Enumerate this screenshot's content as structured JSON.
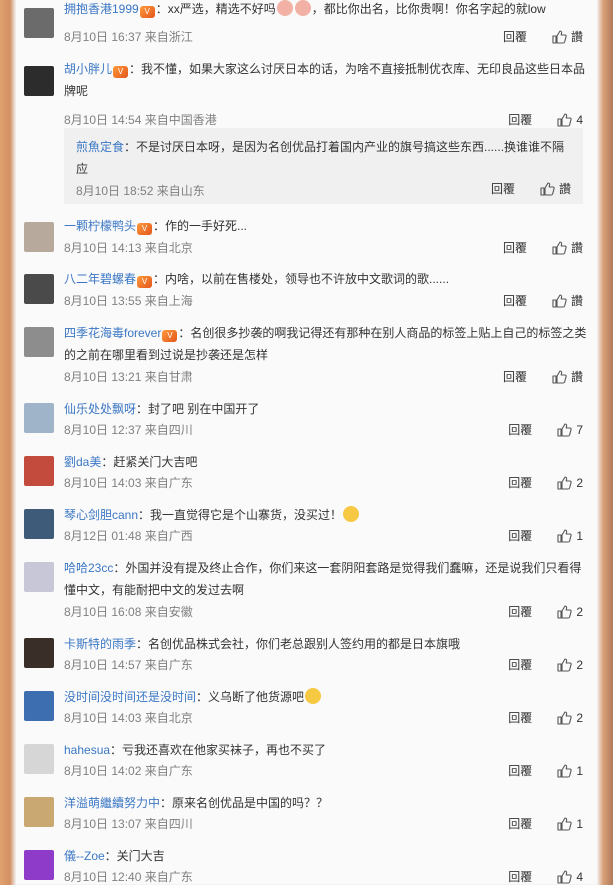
{
  "actions": {
    "reply_label": "回覆",
    "like_label": "讚"
  },
  "comments": [
    {
      "name": "拥抱香港1999",
      "text": "：xx严选，精选不好吗",
      "text2": "，都比你出名，比你贵啊！你名字起的就low",
      "date": "8月10日 16:37",
      "loc": "来自浙江",
      "likes": "讚"
    },
    {
      "name": "胡小胖儿",
      "text": "：我不懂，如果大家这么讨厌日本的话，为啥不直接抵制优衣库、无印良品这些日本品牌呢",
      "date": "8月10日 14:54",
      "loc": "来自中国香港",
      "likes": "4"
    },
    {
      "name": "一颗柠檬鸭头",
      "text": "：作的一手好死...",
      "date": "8月10日 14:13",
      "loc": "来自北京",
      "likes": "讚"
    },
    {
      "name": "八二年碧螺春",
      "text": "：内啥，以前在售楼处，领导也不许放中文歌词的歌......",
      "date": "8月10日 13:55",
      "loc": "来自上海",
      "likes": "讚"
    },
    {
      "name": "四季花海毒forever",
      "text": "：名创很多抄袭的啊我记得还有那种在别人商品的标签上贴上自己的标签之类的之前在哪里看到过说是抄袭还是怎样",
      "date": "8月10日 13:21",
      "loc": "来自甘肃",
      "likes": "讚"
    },
    {
      "name": "仙乐处处飘呀",
      "text": "：封了吧 别在中国开了",
      "date": "8月10日 12:37",
      "loc": "来自四川",
      "likes": "7"
    },
    {
      "name": "劉da美",
      "text": "：赶紧关门大吉吧",
      "date": "8月10日 14:03",
      "loc": "来自广东",
      "likes": "2"
    },
    {
      "name": "琴心剑胆cann",
      "text": "：我一直觉得它是个山寨货，没买过！",
      "date": "8月12日 01:48",
      "loc": "来自广西",
      "likes": "1"
    },
    {
      "name": "哈哈23cc",
      "text": "：外国并没有提及终止合作，你们来这一套阴阳套路是觉得我们蠢嘛，还是说我们只看得懂中文，有能耐把中文的发过去啊",
      "date": "8月10日 16:08",
      "loc": "来自安徽",
      "likes": "2"
    },
    {
      "name": "卡斯特的雨季",
      "text": "：名创优品株式会社，你们老总跟别人签约用的都是日本旗哦",
      "date": "8月10日 14:57",
      "loc": "来自广东",
      "likes": "2"
    },
    {
      "name": "没时间没时间还是没时间",
      "text": "：义乌断了他货源吧",
      "date": "8月10日 14:03",
      "loc": "来自北京",
      "likes": "2"
    },
    {
      "name": "hahesua",
      "text": "：亏我还喜欢在他家买袜子，再也不买了",
      "date": "8月10日 14:02",
      "loc": "来自广东",
      "likes": "1"
    },
    {
      "name": "洋溢萌繼續努力中",
      "text": "：原来名创优品是中国的吗？？",
      "date": "8月10日 13:07",
      "loc": "来自四川",
      "likes": "1"
    },
    {
      "name": "儀--Zoe",
      "text": "：关门大吉",
      "date": "8月10日 12:40",
      "loc": "来自广东",
      "likes": "4"
    }
  ],
  "nested_reply": {
    "name": "煎魚定食",
    "text": "：不是讨厌日本呀，是因为名创优品打着国内产业的旗号搞这些东西......换谁谁不隔应",
    "date": "8月10日 18:52",
    "loc": "来自山东",
    "likes": "讚"
  },
  "colors": {
    "username": "#3b77c4",
    "meta": "#808080",
    "text": "#333333",
    "nested_bg": "#f0f0f0"
  }
}
